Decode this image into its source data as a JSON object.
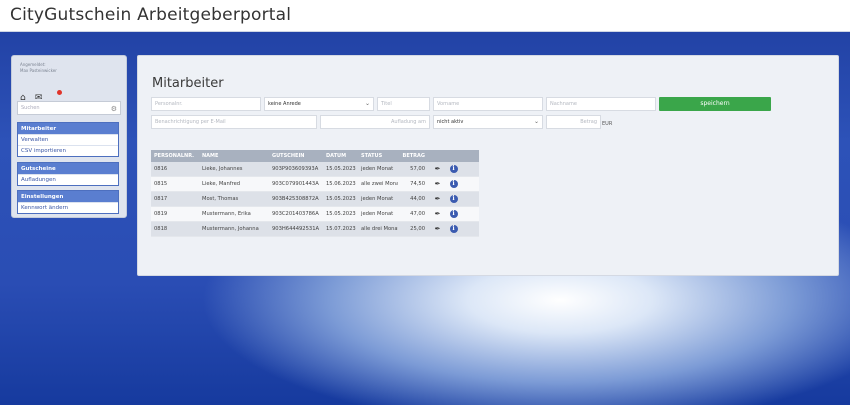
{
  "app": {
    "title": "CityGutschein Arbeitgeberportal"
  },
  "sidebar": {
    "user_label": "Angemeldet:",
    "user_name": "Max Pasteinwicker",
    "search_placeholder": "Suchen",
    "groups": [
      {
        "title": "Mitarbeiter",
        "items": [
          {
            "label": "Verwalten"
          },
          {
            "label": "CSV importieren"
          }
        ]
      },
      {
        "title": "Gutscheine",
        "items": [
          {
            "label": "Aufladungen"
          }
        ]
      },
      {
        "title": "Einstellungen",
        "items": [
          {
            "label": "Kennwort ändern"
          }
        ]
      }
    ]
  },
  "main": {
    "title": "Mitarbeiter",
    "form": {
      "personalnr_placeholder": "Personalnr.",
      "anrede_value": "keine Anrede",
      "titel_placeholder": "Titel",
      "vorname_placeholder": "Vorname",
      "nachname_placeholder": "Nachname",
      "email_placeholder": "Benachrichtigung per E-Mail",
      "aufladung_placeholder": "Aufladung am",
      "status_value": "nicht aktiv",
      "betrag_placeholder": "Betrag",
      "currency": "EUR",
      "save_label": "speichern"
    },
    "table": {
      "headers": [
        "PERSONALNR.",
        "NAME",
        "GUTSCHEIN",
        "DATUM",
        "STATUS",
        "BETRAG"
      ],
      "rows": [
        {
          "personalnr": "0816",
          "name": "Lieke, Johannes",
          "gutschein": "903P903609393A",
          "datum": "15.05.2023",
          "status": "jeden Monat",
          "betrag": "57,00"
        },
        {
          "personalnr": "0815",
          "name": "Lieke, Manfred",
          "gutschein": "903C079901443A",
          "datum": "15.06.2023",
          "status": "alle zwei Monate",
          "betrag": "74,50"
        },
        {
          "personalnr": "0817",
          "name": "Most, Thomas",
          "gutschein": "903B425308872A",
          "datum": "15.05.2023",
          "status": "jeden Monat",
          "betrag": "44,00"
        },
        {
          "personalnr": "0819",
          "name": "Mustermann, Erika",
          "gutschein": "903C201403786A",
          "datum": "15.05.2023",
          "status": "jeden Monat",
          "betrag": "47,00"
        },
        {
          "personalnr": "0818",
          "name": "Mustermann, Johanna",
          "gutschein": "903H644492531A",
          "datum": "15.07.2023",
          "status": "alle drei Monate",
          "betrag": "25,00"
        }
      ]
    }
  },
  "colors": {
    "accent": "#3aa64a",
    "sidebar_group": "#5a7ed0",
    "header_row": "#a8b1bf"
  },
  "icons": {
    "home": "home-icon",
    "notifications": "notification-icon",
    "search": "search-icon",
    "edit": "edit-icon",
    "info": "info-icon"
  }
}
